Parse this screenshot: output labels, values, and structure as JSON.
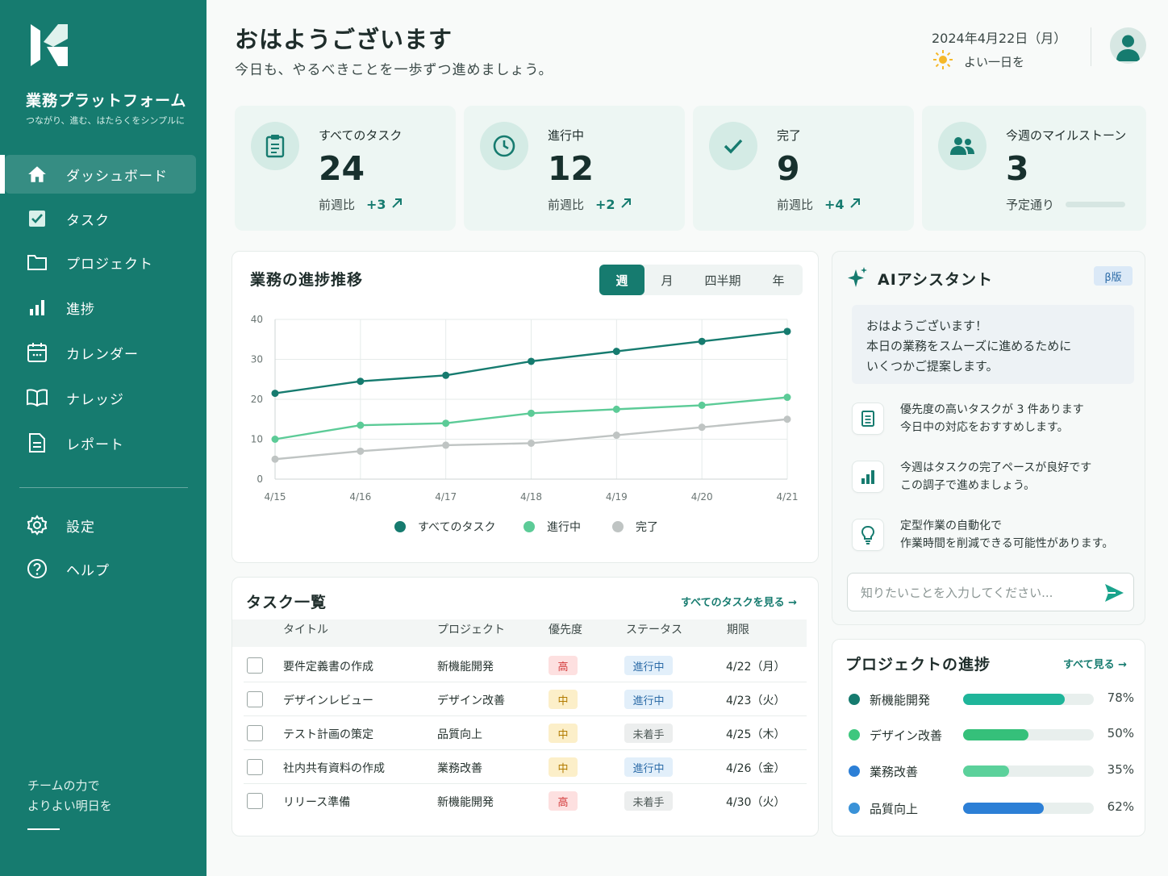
{
  "sidebar": {
    "brand": "業務プラットフォーム",
    "tagline": "つながり、進む、はたらくをシンプルに",
    "items": [
      {
        "label": "ダッシュボード",
        "icon": "home-icon"
      },
      {
        "label": "タスク",
        "icon": "checkbox-icon"
      },
      {
        "label": "プロジェクト",
        "icon": "folder-icon"
      },
      {
        "label": "進捗",
        "icon": "bar-chart-icon"
      },
      {
        "label": "カレンダー",
        "icon": "calendar-icon"
      },
      {
        "label": "ナレッジ",
        "icon": "book-icon"
      },
      {
        "label": "レポート",
        "icon": "document-icon"
      }
    ],
    "bottom_items": [
      {
        "label": "設定",
        "icon": "gear-icon"
      },
      {
        "label": "ヘルプ",
        "icon": "help-icon"
      }
    ],
    "footer_line1": "チームの力で",
    "footer_line2": "よりよい明日を"
  },
  "header": {
    "greeting": "おはようございます",
    "subgreeting": "今日も、やるべきことを一歩ずつ進めましょう。",
    "date": "2024年4月22日（月）",
    "weather_text": "よい一日を"
  },
  "stats": [
    {
      "label": "すべてのタスク",
      "value": "24",
      "compare": "前週比",
      "delta": "+3",
      "icon": "clipboard-icon"
    },
    {
      "label": "進行中",
      "value": "12",
      "compare": "前週比",
      "delta": "+2",
      "icon": "clock-icon"
    },
    {
      "label": "完了",
      "value": "9",
      "compare": "前週比",
      "delta": "+4",
      "icon": "check-icon"
    },
    {
      "label": "今週のマイルストーン",
      "value": "3",
      "compare": "予定通り",
      "icon": "people-icon"
    }
  ],
  "chart_panel": {
    "title": "業務の進捗推移",
    "periods": [
      "週",
      "月",
      "四半期",
      "年"
    ],
    "active_period": "週"
  },
  "chart_data": {
    "type": "line",
    "x": [
      "4/15",
      "4/16",
      "4/17",
      "4/18",
      "4/19",
      "4/20",
      "4/21"
    ],
    "ylim": [
      0,
      40
    ],
    "yticks": [
      0,
      10,
      20,
      30,
      40
    ],
    "grid": true,
    "legend_position": "bottom",
    "series": [
      {
        "name": "すべてのタスク",
        "color": "#167b6f",
        "values": [
          21.5,
          24.5,
          26,
          29.5,
          32,
          34.5,
          37
        ]
      },
      {
        "name": "進行中",
        "color": "#5ccb97",
        "values": [
          10,
          13.5,
          14,
          16.5,
          17.5,
          18.5,
          20.5
        ]
      },
      {
        "name": "完了",
        "color": "#bfc4c3",
        "values": [
          5,
          7,
          8.5,
          9,
          11,
          13,
          15
        ]
      }
    ]
  },
  "tasks": {
    "title": "タスク一覧",
    "view_all": "すべてのタスクを見る →",
    "headers": [
      "タイトル",
      "プロジェクト",
      "優先度",
      "ステータス",
      "期限"
    ],
    "rows": [
      {
        "title": "要件定義書の作成",
        "project": "新機能開発",
        "priority": "高",
        "status": "進行中",
        "due": "4/22（月）"
      },
      {
        "title": "デザインレビュー",
        "project": "デザイン改善",
        "priority": "中",
        "status": "進行中",
        "due": "4/23（火）"
      },
      {
        "title": "テスト計画の策定",
        "project": "品質向上",
        "priority": "中",
        "status": "未着手",
        "due": "4/25（木）"
      },
      {
        "title": "社内共有資料の作成",
        "project": "業務改善",
        "priority": "中",
        "status": "進行中",
        "due": "4/26（金）"
      },
      {
        "title": "リリース準備",
        "project": "新機能開発",
        "priority": "高",
        "status": "未着手",
        "due": "4/30（火）"
      }
    ]
  },
  "ai": {
    "title": "AIアシスタント",
    "badge": "β版",
    "bubble_line1": "おはようございます！",
    "bubble_line2": "本日の業務をスムーズに進めるために",
    "bubble_line3": "いくつかご提案します。",
    "tips": [
      {
        "line1": "優先度の高いタスクが 3 件あります",
        "line2": "今日中の対応をおすすめします。",
        "icon": "document-icon"
      },
      {
        "line1": "今週はタスクの完了ペースが良好です",
        "line2": "この調子で進めましょう。",
        "icon": "bar-chart-icon"
      },
      {
        "line1": "定型作業の自動化で",
        "line2": "作業時間を削減できる可能性があります。",
        "icon": "lightbulb-icon"
      }
    ],
    "input_placeholder": "知りたいことを入力してください..."
  },
  "projects": {
    "title": "プロジェクトの進捗",
    "view_all": "すべて見る →",
    "items": [
      {
        "name": "新機能開発",
        "percent": 78,
        "percent_label": "78%",
        "dot": "#167b6f",
        "bar": "#1fb59a"
      },
      {
        "name": "デザイン改善",
        "percent": 50,
        "percent_label": "50%",
        "dot": "#3ec77e",
        "bar": "#35c07a"
      },
      {
        "name": "業務改善",
        "percent": 35,
        "percent_label": "35%",
        "dot": "#2c7fd6",
        "bar": "#5bd19b"
      },
      {
        "name": "品質向上",
        "percent": 62,
        "percent_label": "62%",
        "dot": "#3a92d8",
        "bar": "#2c7fd6"
      }
    ]
  }
}
